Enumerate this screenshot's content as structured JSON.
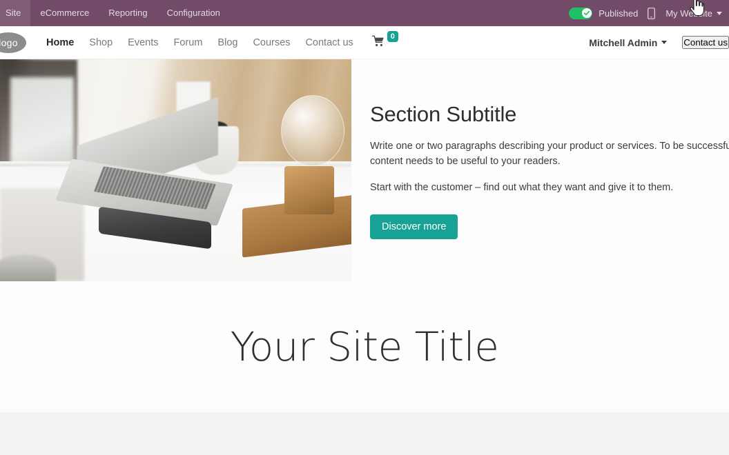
{
  "backend_bar": {
    "menu_items": [
      {
        "label": "Site"
      },
      {
        "label": "eCommerce"
      },
      {
        "label": "Reporting"
      },
      {
        "label": "Configuration"
      }
    ],
    "publish": {
      "label": "Published",
      "state": "on",
      "icon": "check-icon",
      "color": "#1FC066"
    },
    "mobile_preview_icon": "mobile-icon",
    "website_switcher": {
      "label": "My Website",
      "caret_icon": "chevron-down-icon"
    },
    "cursor_icon": "pointer-hand-cursor",
    "background_color": "#714B67"
  },
  "site_navbar": {
    "logo_text": "logo",
    "links": [
      {
        "label": "Home",
        "active": true
      },
      {
        "label": "Shop",
        "active": false
      },
      {
        "label": "Events",
        "active": false
      },
      {
        "label": "Forum",
        "active": false
      },
      {
        "label": "Blog",
        "active": false
      },
      {
        "label": "Courses",
        "active": false
      },
      {
        "label": "Contact us",
        "active": false
      }
    ],
    "cart": {
      "icon": "shopping-cart-icon",
      "count": "0",
      "badge_color": "#17A295"
    },
    "user_menu": {
      "label": "Mitchell Admin",
      "caret_icon": "chevron-down-icon"
    },
    "contact_button": {
      "label": "Contact us",
      "color": "#17A295"
    }
  },
  "hero": {
    "image_alt": "desk-with-laptop-phone-and-lamp-photo",
    "title": "Section Subtitle",
    "paragraph_1": "Write one or two paragraphs describing your product or services. To be successful your content needs to be useful to your readers.",
    "paragraph_2": "Start with the customer – find out what they want and give it to them.",
    "cta_label": "Discover more",
    "cta_color": "#17A295"
  },
  "site_title_section": {
    "title": "Your Site Title"
  }
}
